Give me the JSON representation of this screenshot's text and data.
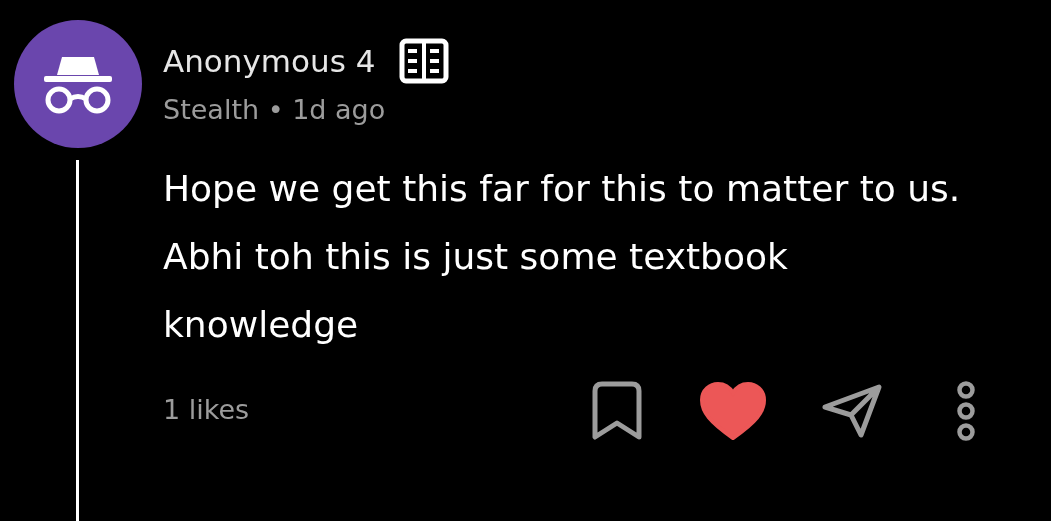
{
  "comment": {
    "author": "Anonymous 4",
    "group": "Stealth",
    "separator": "•",
    "time": "1d ago",
    "text": "Hope we get this far for this to matter to us. Abhi toh this is just some textbook knowledge",
    "likes": "1 likes",
    "liked": true,
    "bookmarked": false
  }
}
